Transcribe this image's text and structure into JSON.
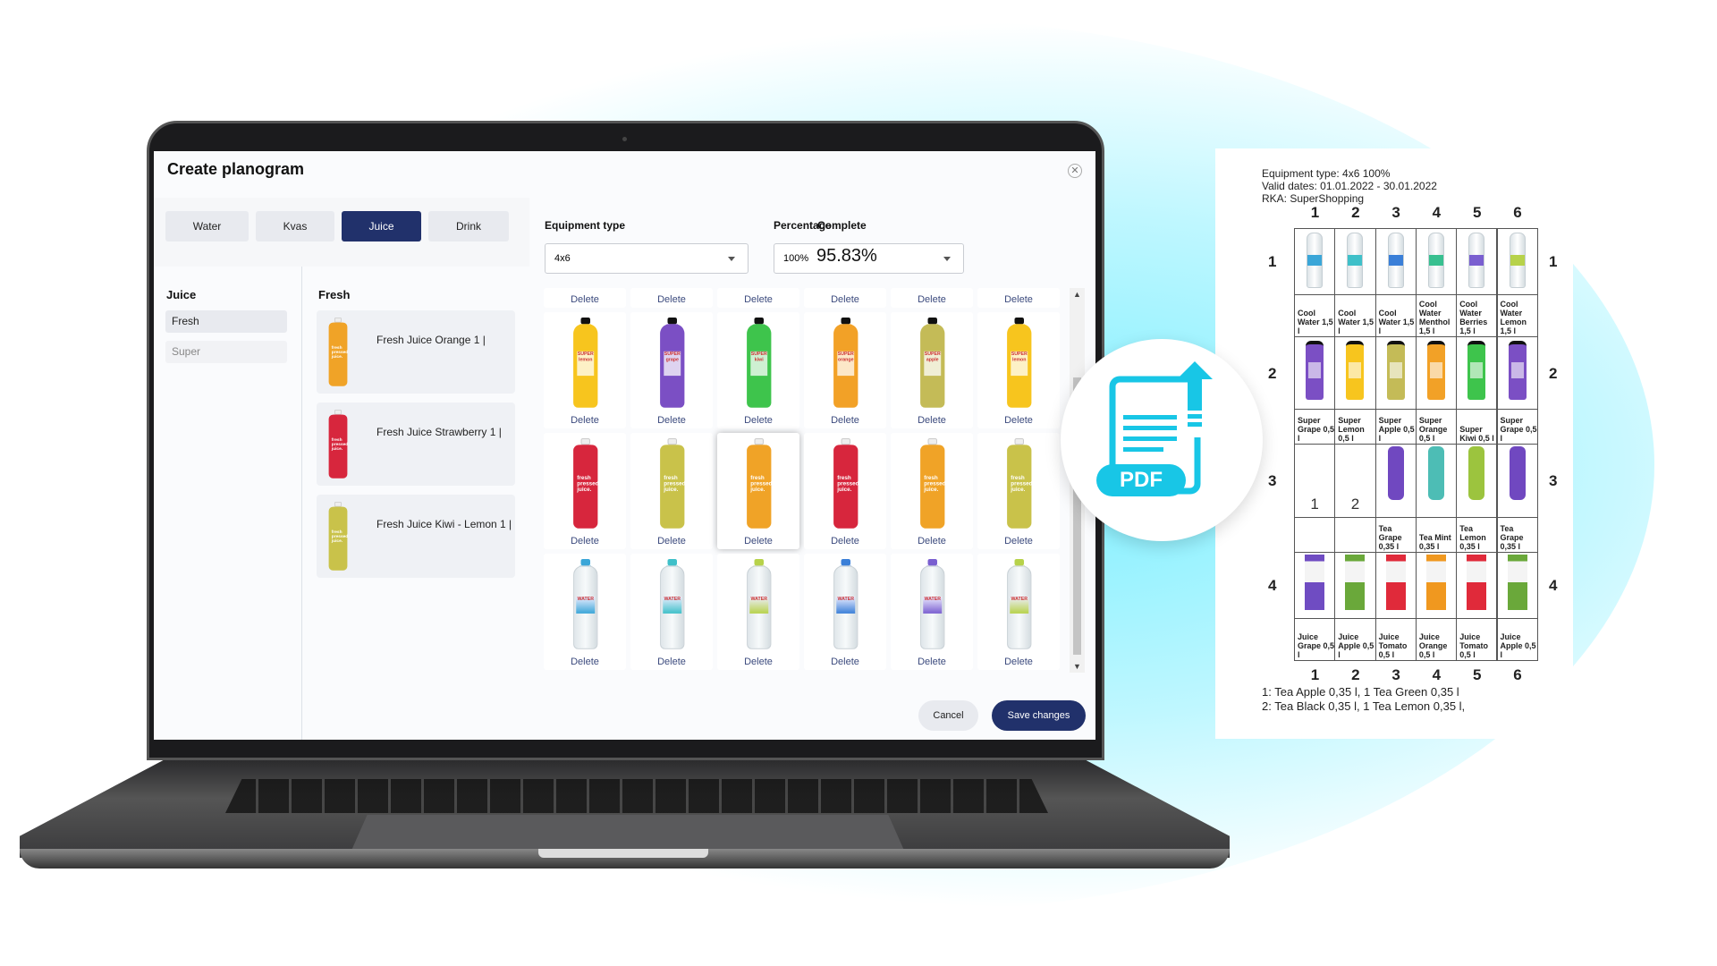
{
  "dialog": {
    "title": "Create planogram",
    "close_icon": "close-icon"
  },
  "tabs": [
    {
      "label": "Water"
    },
    {
      "label": "Kvas"
    },
    {
      "label": "Juice",
      "active": true
    },
    {
      "label": "Drink"
    }
  ],
  "category": {
    "heading": "Juice",
    "items": [
      {
        "label": "Fresh",
        "selected": true
      },
      {
        "label": "Super"
      }
    ]
  },
  "products": {
    "heading": "Fresh",
    "items": [
      {
        "name": "Fresh Juice Orange 1 |",
        "color": "#f0a327"
      },
      {
        "name": "Fresh Juice Strawberry 1 |",
        "color": "#d7263d"
      },
      {
        "name": "Fresh Juice Kiwi - Lemon 1 |",
        "color": "#c9c24a"
      }
    ]
  },
  "equipment": {
    "label": "Equipment type",
    "value": "4x6"
  },
  "percentage": {
    "label": "Percentage",
    "value": "100%"
  },
  "complete": {
    "label": "Complete",
    "value": "95.83%"
  },
  "grid": {
    "delete_label": "Delete",
    "rows": [
      [
        {
          "type": "super",
          "color": "#f7c51e",
          "text": "SUPER lemon"
        },
        {
          "type": "super",
          "color": "#7b4fc4",
          "text": "SUPER grape"
        },
        {
          "type": "super",
          "color": "#3ec44c",
          "text": "SUPER kiwi"
        },
        {
          "type": "super",
          "color": "#f2a127",
          "text": "SUPER orange"
        },
        {
          "type": "super",
          "color": "#c4bb57",
          "text": "SUPER apple"
        },
        {
          "type": "super",
          "color": "#f7c51e",
          "text": "SUPER lemon"
        }
      ],
      [
        {
          "type": "fresh",
          "color": "#d7263d",
          "text": "fresh pressed juice."
        },
        {
          "type": "fresh",
          "color": "#c9c24a",
          "text": "fresh pressed juice."
        },
        {
          "type": "fresh",
          "color": "#f0a327",
          "text": "fresh pressed juice.",
          "dragging": true
        },
        {
          "type": "fresh",
          "color": "#d7263d",
          "text": "fresh pressed juice."
        },
        {
          "type": "fresh",
          "color": "#f0a327",
          "text": "fresh pressed juice."
        },
        {
          "type": "fresh",
          "color": "#c9c24a",
          "text": "fresh pressed juice."
        }
      ],
      [
        {
          "type": "water",
          "color": "#3aa6d8",
          "text": "WATER"
        },
        {
          "type": "water",
          "color": "#3fc0c9",
          "text": "WATER"
        },
        {
          "type": "water",
          "color": "#b7d24a",
          "text": "WATER"
        },
        {
          "type": "water",
          "color": "#3a7fd8",
          "text": "WATER"
        },
        {
          "type": "water",
          "color": "#7a5fd0",
          "text": "WATER"
        },
        {
          "type": "water",
          "color": "#b7d24a",
          "text": "WATER"
        }
      ]
    ]
  },
  "actions": {
    "cancel": "Cancel",
    "save": "Save changes"
  },
  "pdf_badge": {
    "label": "PDF",
    "accent": "#18c6e6"
  },
  "document": {
    "header": [
      "Equipment type: 4x6 100%",
      "Valid dates: 01.01.2022 - 30.01.2022",
      "RKA: SuperShopping"
    ],
    "columns": [
      "1",
      "2",
      "3",
      "4",
      "5",
      "6"
    ],
    "rows": [
      {
        "number": "1",
        "cells": [
          {
            "label": "Cool Water 1,5 l",
            "color": "#3aa6d8",
            "kind": "water"
          },
          {
            "label": "Cool Water 1,5 l",
            "color": "#3fc0c9",
            "kind": "water"
          },
          {
            "label": "Cool Water 1,5 l",
            "color": "#3a7fd8",
            "kind": "water"
          },
          {
            "label": "Cool Water Menthol 1,5 l",
            "color": "#38c090",
            "kind": "water"
          },
          {
            "label": "Cool Water Berries 1,5 l",
            "color": "#7a5fd0",
            "kind": "water"
          },
          {
            "label": "Cool Water Lemon 1,5 l",
            "color": "#b7d24a",
            "kind": "water"
          }
        ]
      },
      {
        "number": "2",
        "cells": [
          {
            "label": "Super Grape 0,5 l",
            "color": "#7b4fc4",
            "kind": "super"
          },
          {
            "label": "Super Lemon 0,5 l",
            "color": "#f7c51e",
            "kind": "super"
          },
          {
            "label": "Super Apple 0,5 l",
            "color": "#c4bb57",
            "kind": "super"
          },
          {
            "label": "Super Orange 0,5 l",
            "color": "#f2a127",
            "kind": "super"
          },
          {
            "label": "Super Kiwi 0,5 l",
            "color": "#3ec44c",
            "kind": "super"
          },
          {
            "label": "Super Grape 0,5 l",
            "color": "#7b4fc4",
            "kind": "super"
          }
        ]
      },
      {
        "number": "3",
        "cells": [
          {
            "label": "",
            "marker": "1"
          },
          {
            "label": "",
            "marker": "2"
          },
          {
            "label": "Tea Grape 0,35 l",
            "color": "#7048c0",
            "kind": "tea"
          },
          {
            "label": "Tea Mint 0,35 l",
            "color": "#4dbdb5",
            "kind": "tea"
          },
          {
            "label": "Tea Lemon 0,35 l",
            "color": "#9cc43e",
            "kind": "tea"
          },
          {
            "label": "Tea Grape 0,35 l",
            "color": "#7048c0",
            "kind": "tea"
          }
        ]
      },
      {
        "number": "4",
        "cells": [
          {
            "label": "Juice Grape 0,5 l",
            "color": "#6f4cc2",
            "kind": "pack"
          },
          {
            "label": "Juice Apple 0,5 l",
            "color": "#6aa83a",
            "kind": "pack"
          },
          {
            "label": "Juice Tomato 0,5 l",
            "color": "#e02a3a",
            "kind": "pack"
          },
          {
            "label": "Juice Orange 0,5 l",
            "color": "#f0981f",
            "kind": "pack"
          },
          {
            "label": "Juice Tomato 0,5 l",
            "color": "#e02a3a",
            "kind": "pack"
          },
          {
            "label": "Juice Apple 0,5 l",
            "color": "#6aa83a",
            "kind": "pack"
          }
        ]
      }
    ],
    "footnotes": [
      "1: Tea Apple 0,35 l,   1 Tea Green 0,35 l",
      "2: Tea Black 0,35 l,   1 Tea Lemon 0,35 l,"
    ]
  }
}
